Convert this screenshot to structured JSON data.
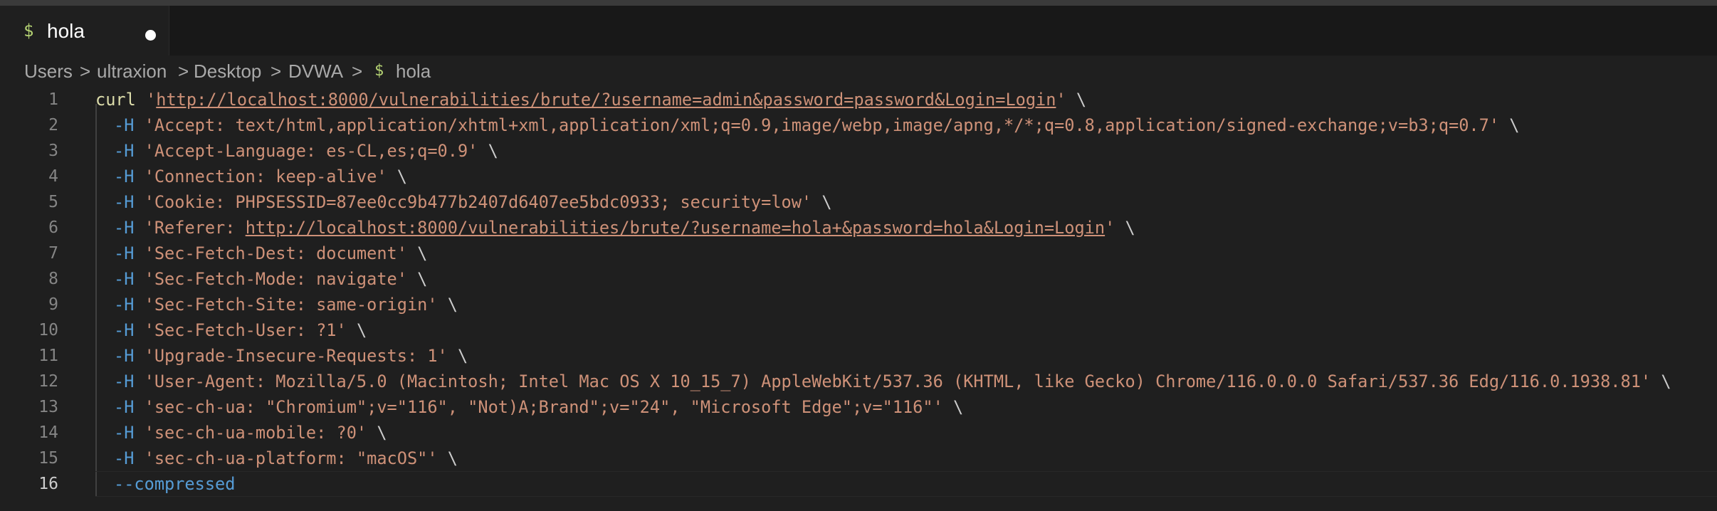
{
  "tab": {
    "icon": "$",
    "icon_name": "terminal-dollar-icon",
    "label": "hola",
    "dirty": true
  },
  "breadcrumb": {
    "items": [
      "Users",
      "ultraxion",
      "Desktop",
      "DVWA"
    ],
    "file_icon": "$",
    "file_label": "hola",
    "separator": ">"
  },
  "colors": {
    "background": "#1f1f1f",
    "tabbar": "#181818",
    "command": "#dcdcaa",
    "string": "#ce9178",
    "flag": "#569cd6",
    "shell_icon": "#b4d273"
  },
  "editor": {
    "current_line": 16,
    "lines": [
      {
        "n": "1",
        "cmd": "curl",
        "flag": "",
        "pre": " '",
        "url": "http://localhost:8000/vulnerabilities/brute/?username=admin&password=password&Login=Login",
        "post": "'",
        "cont": " \\"
      },
      {
        "n": "2",
        "cmd": "",
        "flag": "-H",
        "pre": " 'Accept: text/html,application/xhtml+xml,application/xml;q=0.9,image/webp,image/apng,*/*;q=0.8,application/signed-exchange;v=b3;q=0.7'",
        "url": "",
        "post": "",
        "cont": " \\"
      },
      {
        "n": "3",
        "cmd": "",
        "flag": "-H",
        "pre": " 'Accept-Language: es-CL,es;q=0.9'",
        "url": "",
        "post": "",
        "cont": " \\"
      },
      {
        "n": "4",
        "cmd": "",
        "flag": "-H",
        "pre": " 'Connection: keep-alive'",
        "url": "",
        "post": "",
        "cont": " \\"
      },
      {
        "n": "5",
        "cmd": "",
        "flag": "-H",
        "pre": " 'Cookie: PHPSESSID=87ee0cc9b477b2407d6407ee5bdc0933; security=low'",
        "url": "",
        "post": "",
        "cont": " \\"
      },
      {
        "n": "6",
        "cmd": "",
        "flag": "-H",
        "pre": " 'Referer: ",
        "url": "http://localhost:8000/vulnerabilities/brute/?username=hola+&password=hola&Login=Login",
        "post": "'",
        "cont": " \\"
      },
      {
        "n": "7",
        "cmd": "",
        "flag": "-H",
        "pre": " 'Sec-Fetch-Dest: document'",
        "url": "",
        "post": "",
        "cont": " \\"
      },
      {
        "n": "8",
        "cmd": "",
        "flag": "-H",
        "pre": " 'Sec-Fetch-Mode: navigate'",
        "url": "",
        "post": "",
        "cont": " \\"
      },
      {
        "n": "9",
        "cmd": "",
        "flag": "-H",
        "pre": " 'Sec-Fetch-Site: same-origin'",
        "url": "",
        "post": "",
        "cont": " \\"
      },
      {
        "n": "10",
        "cmd": "",
        "flag": "-H",
        "pre": " 'Sec-Fetch-User: ?1'",
        "url": "",
        "post": "",
        "cont": " \\"
      },
      {
        "n": "11",
        "cmd": "",
        "flag": "-H",
        "pre": " 'Upgrade-Insecure-Requests: 1'",
        "url": "",
        "post": "",
        "cont": " \\"
      },
      {
        "n": "12",
        "cmd": "",
        "flag": "-H",
        "pre": " 'User-Agent: Mozilla/5.0 (Macintosh; Intel Mac OS X 10_15_7) AppleWebKit/537.36 (KHTML, like Gecko) Chrome/116.0.0.0 Safari/537.36 Edg/116.0.1938.81'",
        "url": "",
        "post": "",
        "cont": " \\"
      },
      {
        "n": "13",
        "cmd": "",
        "flag": "-H",
        "pre": " 'sec-ch-ua: \"Chromium\";v=\"116\", \"Not)A;Brand\";v=\"24\", \"Microsoft Edge\";v=\"116\"'",
        "url": "",
        "post": "",
        "cont": " \\"
      },
      {
        "n": "14",
        "cmd": "",
        "flag": "-H",
        "pre": " 'sec-ch-ua-mobile: ?0'",
        "url": "",
        "post": "",
        "cont": " \\"
      },
      {
        "n": "15",
        "cmd": "",
        "flag": "-H",
        "pre": " 'sec-ch-ua-platform: \"macOS\"'",
        "url": "",
        "post": "",
        "cont": " \\"
      },
      {
        "n": "16",
        "cmd": "",
        "flag": "--compressed",
        "pre": "",
        "url": "",
        "post": "",
        "cont": ""
      }
    ]
  }
}
